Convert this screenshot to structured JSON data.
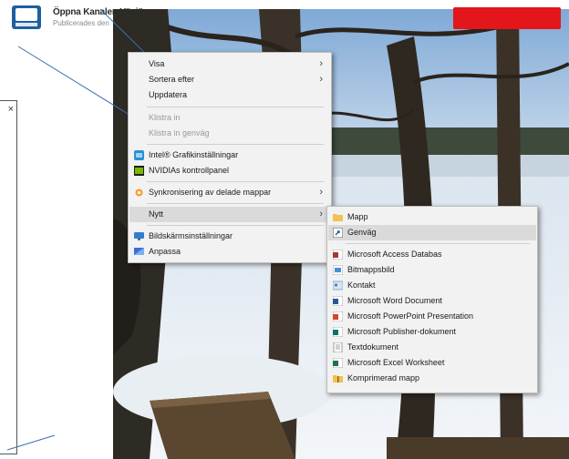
{
  "header": {
    "title": "Öppna Kanalen Växjö",
    "subtitle": "Publicerades den"
  },
  "side_panel": {
    "close_glyph": "×"
  },
  "context_menu": {
    "items": [
      {
        "label": "Visa",
        "submenu": true
      },
      {
        "label": "Sortera efter",
        "submenu": true
      },
      {
        "label": "Uppdatera"
      },
      {
        "label": "Klistra in",
        "disabled": true
      },
      {
        "label": "Klistra in genväg",
        "disabled": true
      },
      {
        "label": "Intel® Grafikinställningar",
        "icon": "intel-graphics-icon"
      },
      {
        "label": "NVIDIAs kontrollpanel",
        "icon": "nvidia-icon"
      },
      {
        "label": "Synkronisering av delade mappar",
        "icon": "sync-icon",
        "submenu": true
      },
      {
        "label": "Nytt",
        "submenu": true,
        "highlighted": true
      },
      {
        "label": "Bildskärmsinställningar",
        "icon": "display-settings-icon"
      },
      {
        "label": "Anpassa",
        "icon": "personalize-icon"
      }
    ]
  },
  "new_submenu": {
    "items": [
      {
        "label": "Mapp",
        "icon": "folder-icon"
      },
      {
        "label": "Genväg",
        "icon": "shortcut-icon",
        "highlighted": true
      },
      {
        "label": "Microsoft Access Databas",
        "icon": "access-icon"
      },
      {
        "label": "Bitmappsbild",
        "icon": "bitmap-icon"
      },
      {
        "label": "Kontakt",
        "icon": "contact-icon"
      },
      {
        "label": "Microsoft Word Document",
        "icon": "word-icon"
      },
      {
        "label": "Microsoft PowerPoint Presentation",
        "icon": "powerpoint-icon"
      },
      {
        "label": "Microsoft Publisher-dokument",
        "icon": "publisher-icon"
      },
      {
        "label": "Textdokument",
        "icon": "text-document-icon"
      },
      {
        "label": "Microsoft Excel Worksheet",
        "icon": "excel-icon"
      },
      {
        "label": "Komprimerad mapp",
        "icon": "zip-folder-icon"
      }
    ]
  },
  "colors": {
    "accent_red": "#e3161b",
    "annotation_line": "#3a6fb0",
    "menu_background": "#f2f2f2",
    "menu_highlight": "#dadada"
  }
}
